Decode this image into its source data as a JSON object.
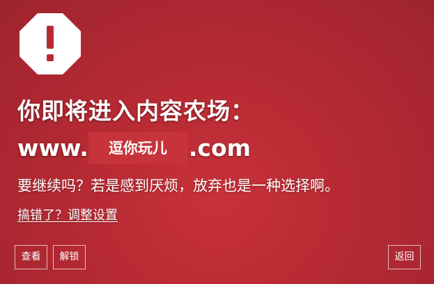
{
  "warning": {
    "icon": "octagon-exclamation-icon",
    "icon_color": "#ffffff",
    "glyph_color": "#b82a33",
    "title": "你即将进入内容农场：",
    "domain_prefix": "www.",
    "domain_redaction": "逗你玩儿",
    "domain_suffix": ".com",
    "message": "要继续吗？若是感到厌烦，放弃也是一种选择啊。",
    "settings_link": "搞错了？调整设置"
  },
  "buttons": {
    "view": "查看",
    "unlock": "解锁",
    "back": "返回"
  },
  "colors": {
    "background": "#b82a33",
    "text": "#ffffff"
  }
}
